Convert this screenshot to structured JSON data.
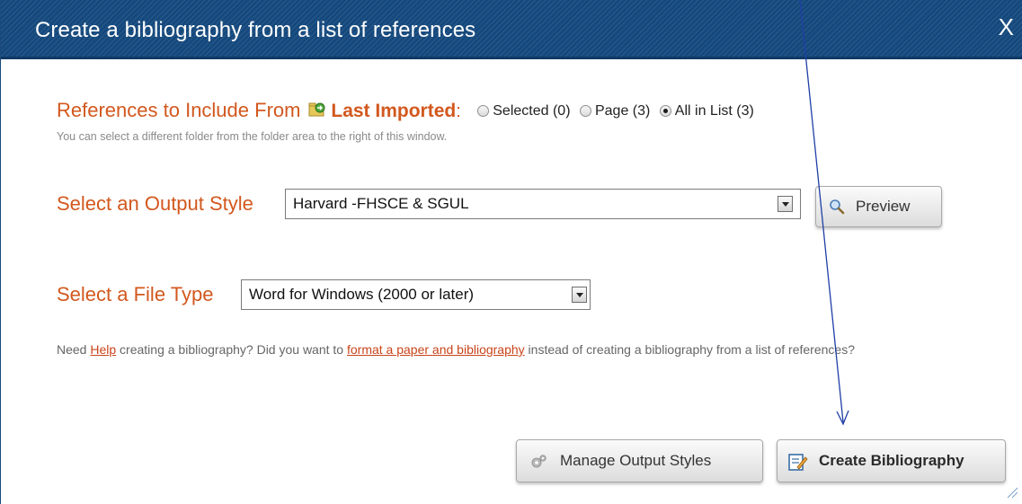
{
  "dialog": {
    "title": "Create a bibliography from a list of references",
    "close_label": "X"
  },
  "references": {
    "label": "References to Include From",
    "folder_icon": "folder-icon",
    "folder_name": "Last Imported",
    "colon": ":",
    "options": [
      {
        "label": "Selected (0)",
        "checked": false
      },
      {
        "label": "Page (3)",
        "checked": false
      },
      {
        "label": "All in List (3)",
        "checked": true
      }
    ],
    "hint": "You can select a different folder from the folder area to the right of this window."
  },
  "output_style": {
    "label": "Select an Output Style",
    "value": "Harvard -FHSCE & SGUL",
    "preview_label": "Preview",
    "preview_icon": "magnifier-icon"
  },
  "file_type": {
    "label": "Select a File Type",
    "value": "Word for Windows (2000 or later)"
  },
  "help": {
    "part1": "Need ",
    "help_link": "Help",
    "part2": " creating a bibliography? Did you want to ",
    "format_link": "format a paper and bibliography",
    "part3": " instead of creating a bibliography from a list of references?"
  },
  "buttons": {
    "manage_label": "Manage Output Styles",
    "manage_icon": "gear-icon",
    "create_label": "Create Bibliography",
    "create_icon": "edit-document-icon"
  },
  "colors": {
    "titlebar": "#15497d",
    "accent_orange": "#d2581e",
    "link": "#c9441a",
    "annotation_arrow": "#1f3fa6"
  }
}
